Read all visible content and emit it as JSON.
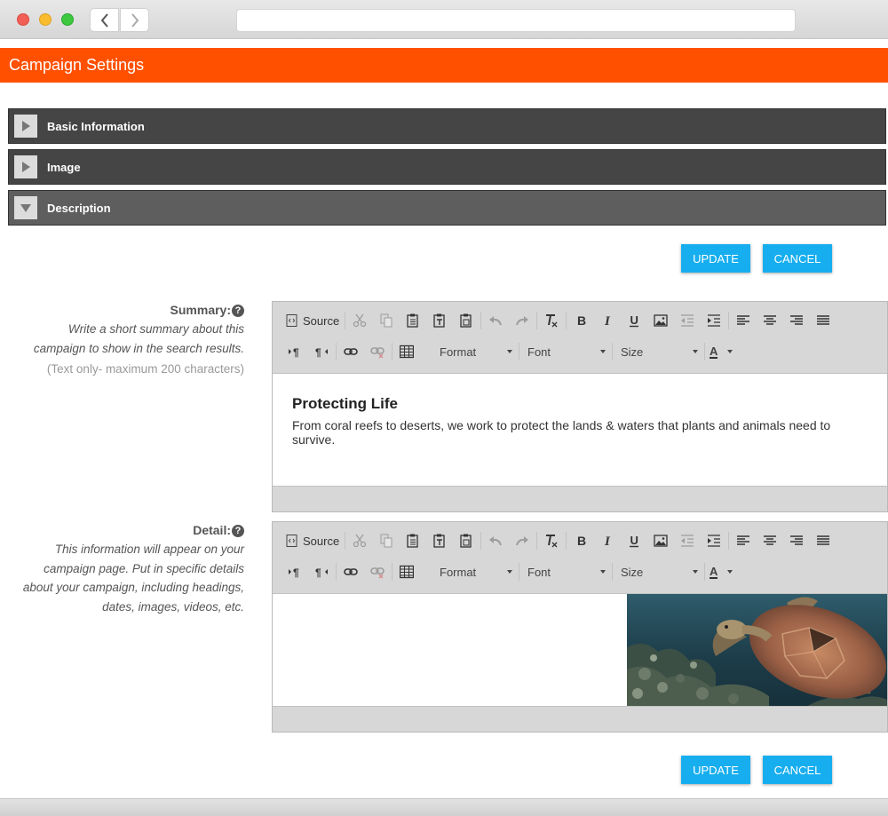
{
  "app": {
    "title": "Campaign Settings",
    "accent_color": "#ff5000",
    "button_color": "#17aeef"
  },
  "browser": {
    "back_icon": "chevron-left-icon",
    "forward_icon": "chevron-right-icon",
    "address": ""
  },
  "sections": [
    {
      "label": "Basic Information",
      "state": "collapsed"
    },
    {
      "label": "Image",
      "state": "collapsed"
    },
    {
      "label": "Description",
      "state": "expanded"
    }
  ],
  "actions": {
    "update_label": "UPDATE",
    "cancel_label": "CANCEL"
  },
  "summary": {
    "label": "Summary:",
    "help_icon": "?",
    "description": "Write a short summary about this campaign to show in the search results.",
    "note": "(Text only- maximum 200 characters)",
    "content_heading": "Protecting Life",
    "content_body": "From coral reefs to deserts, we work to protect the lands & waters that plants and animals need to survive."
  },
  "detail": {
    "label": "Detail:",
    "help_icon": "?",
    "description": "This information will appear on your campaign page. Put in specific details about your campaign, including headings, dates, images, videos, etc."
  },
  "toolbar": {
    "source_label": "Source",
    "format_label": "Format",
    "font_label": "Font",
    "size_label": "Size",
    "text_color_label": "A"
  }
}
